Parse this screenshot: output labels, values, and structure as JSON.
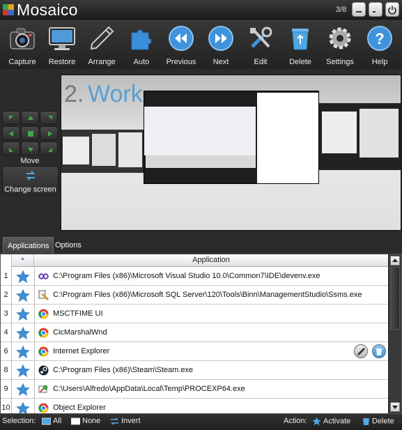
{
  "app": {
    "title": "Mosaico",
    "counter": "3/8"
  },
  "window_buttons": [
    {
      "name": "minimize-button"
    },
    {
      "name": "restore-button"
    },
    {
      "name": "power-button"
    }
  ],
  "toolbar": [
    {
      "label": "Capture",
      "icon": "camera-icon"
    },
    {
      "label": "Restore",
      "icon": "monitor-icon"
    },
    {
      "label": "Arrange",
      "icon": "pencil-icon"
    },
    {
      "label": "Auto",
      "icon": "puzzle-icon"
    },
    {
      "label": "Previous",
      "icon": "rewind-icon"
    },
    {
      "label": "Next",
      "icon": "fast-forward-icon"
    },
    {
      "label": "Edit",
      "icon": "tools-icon"
    },
    {
      "label": "Delete",
      "icon": "recycle-bin-icon"
    },
    {
      "label": "Settings",
      "icon": "gear-icon"
    },
    {
      "label": "Help",
      "icon": "help-icon"
    }
  ],
  "move": {
    "label": "Move",
    "change_screen": "Change screen"
  },
  "workspace": {
    "number": "2.",
    "name": "Work"
  },
  "tabs": [
    {
      "label": "Applications",
      "active": true
    },
    {
      "label": "Options",
      "active": false
    }
  ],
  "table": {
    "header": "Application",
    "rows": [
      {
        "num": "1",
        "icon": "visual-studio-icon",
        "path": "C:\\Program Files (x86)\\Microsoft Visual Studio 10.0\\Common7\\IDE\\devenv.exe"
      },
      {
        "num": "2",
        "icon": "sql-server-icon",
        "path": "C:\\Program Files (x86)\\Microsoft SQL Server\\120\\Tools\\Binn\\ManagementStudio\\Ssms.exe"
      },
      {
        "num": "3",
        "icon": "chrome-icon",
        "path": "MSCTFIME UI"
      },
      {
        "num": "4",
        "icon": "chrome-icon",
        "path": "CicMarshalWnd"
      },
      {
        "num": "6",
        "icon": "chrome-icon",
        "path": "Internet Explorer"
      },
      {
        "num": "8",
        "icon": "steam-icon",
        "path": "C:\\Program Files (x86)\\Steam\\Steam.exe"
      },
      {
        "num": "9",
        "icon": "process-explorer-icon",
        "path": "C:\\Users\\Alfredo\\AppData\\Local\\Temp\\PROCEXP64.exe"
      },
      {
        "num": "10",
        "icon": "chrome-icon",
        "path": "Object Explorer"
      }
    ]
  },
  "status": {
    "selection_label": "Selection:",
    "all": "All",
    "none": "None",
    "invert": "Invert",
    "action_label": "Action:",
    "activate": "Activate",
    "delete": "Delete"
  },
  "colors": {
    "accent_blue": "#5a9fd4",
    "star_blue": "#3d8fd6",
    "background": "#2b2b2b"
  }
}
